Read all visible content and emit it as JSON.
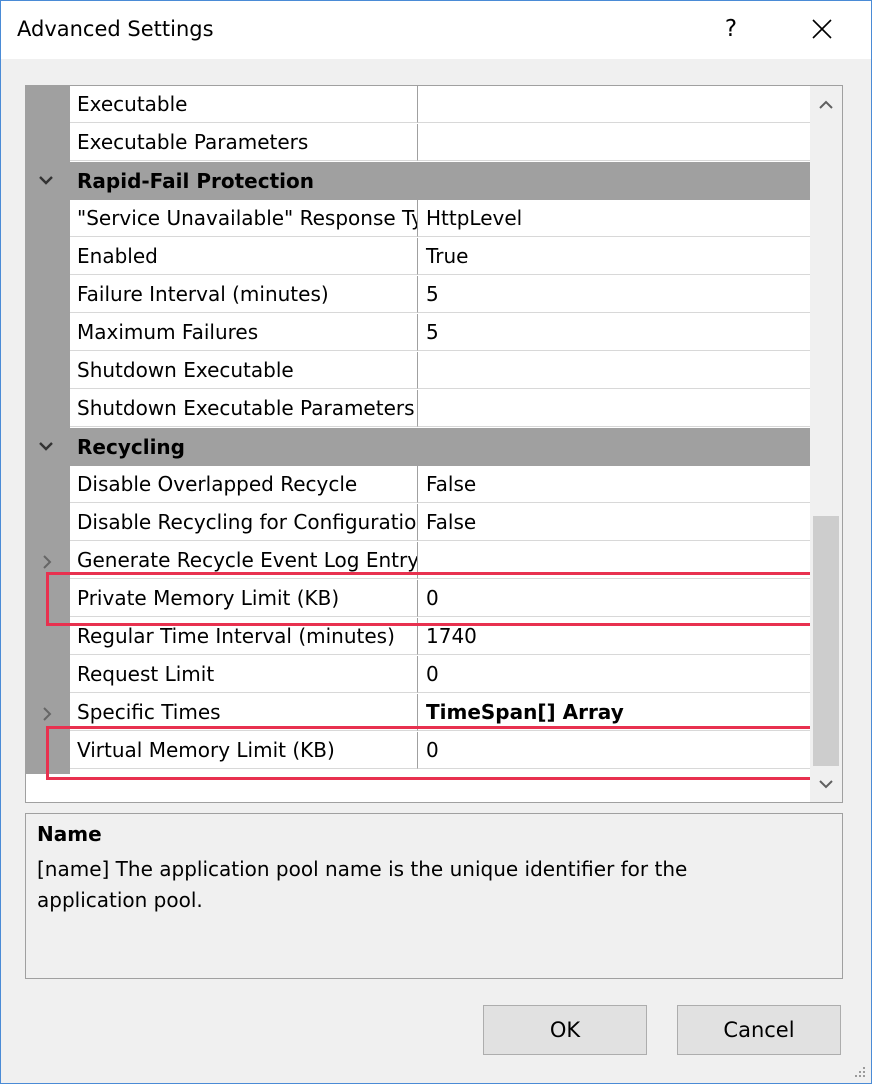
{
  "window": {
    "title": "Advanced Settings",
    "help_label": "?",
    "close_icon": "close-icon"
  },
  "grid": {
    "rows": [
      {
        "type": "prop",
        "name": "Executable",
        "value": ""
      },
      {
        "type": "prop",
        "name": "Executable Parameters",
        "value": ""
      },
      {
        "type": "category",
        "name": "Rapid-Fail Protection"
      },
      {
        "type": "prop",
        "name": "\"Service Unavailable\" Response Type",
        "value": "HttpLevel"
      },
      {
        "type": "prop",
        "name": "Enabled",
        "value": "True"
      },
      {
        "type": "prop",
        "name": "Failure Interval (minutes)",
        "value": "5"
      },
      {
        "type": "prop",
        "name": "Maximum Failures",
        "value": "5"
      },
      {
        "type": "prop",
        "name": "Shutdown Executable",
        "value": ""
      },
      {
        "type": "prop",
        "name": "Shutdown Executable Parameters",
        "value": ""
      },
      {
        "type": "category",
        "name": "Recycling"
      },
      {
        "type": "prop",
        "name": "Disable Overlapped Recycle",
        "value": "False"
      },
      {
        "type": "prop",
        "name": "Disable Recycling for Configuration Changes",
        "value": "False"
      },
      {
        "type": "prop",
        "name": "Generate Recycle Event Log Entry",
        "value": "",
        "expandable": true
      },
      {
        "type": "prop",
        "name": "Private Memory Limit (KB)",
        "value": "0",
        "highlight": true
      },
      {
        "type": "prop",
        "name": "Regular Time Interval (minutes)",
        "value": "1740"
      },
      {
        "type": "prop",
        "name": "Request Limit",
        "value": "0"
      },
      {
        "type": "prop",
        "name": "Specific Times",
        "value": "TimeSpan[] Array",
        "expandable": true,
        "bold_value": true
      },
      {
        "type": "prop",
        "name": "Virtual Memory Limit (KB)",
        "value": "0",
        "highlight": true
      }
    ]
  },
  "description": {
    "title": "Name",
    "text": "[name] The application pool name is the unique identifier for the application pool."
  },
  "buttons": {
    "ok": "OK",
    "cancel": "Cancel"
  },
  "colors": {
    "highlight": "#e8314f",
    "category_bg": "#a0a0a0",
    "border_accent": "#4a8bd6"
  }
}
